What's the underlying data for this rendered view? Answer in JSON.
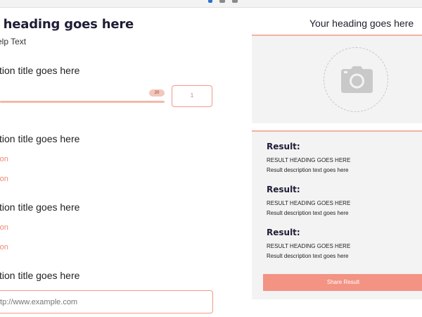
{
  "form": {
    "heading": "n heading goes here",
    "help_text": "elp Text",
    "questions": [
      {
        "title": "stion title goes here"
      },
      {
        "title": "stion title goes here"
      },
      {
        "title": "stion title goes here"
      },
      {
        "title": "stion title goes here"
      }
    ],
    "slider": {
      "max_label": "20",
      "value": "1"
    },
    "options_q2": [
      "ption",
      "ption"
    ],
    "options_q3": [
      "ption",
      "ption"
    ],
    "url_placeholder": "ttp://www.example.com"
  },
  "sidebar": {
    "heading": "Your heading goes here",
    "image_icon": "camera-icon",
    "results": [
      {
        "label": "Result:",
        "heading": "RESULT HEADING GOES HERE",
        "description": "Result description text goes here"
      },
      {
        "label": "Result:",
        "heading": "RESULT HEADING GOES HERE",
        "description": "Result description text goes here"
      },
      {
        "label": "Result:",
        "heading": "RESULT HEADING GOES HERE",
        "description": "Result description text goes here"
      }
    ],
    "share_label": "Share Result"
  },
  "colors": {
    "accent": "#f39383",
    "accent_border": "#f09a87",
    "panel_bg": "#f3f3f3",
    "heading": "#1e1e36"
  }
}
